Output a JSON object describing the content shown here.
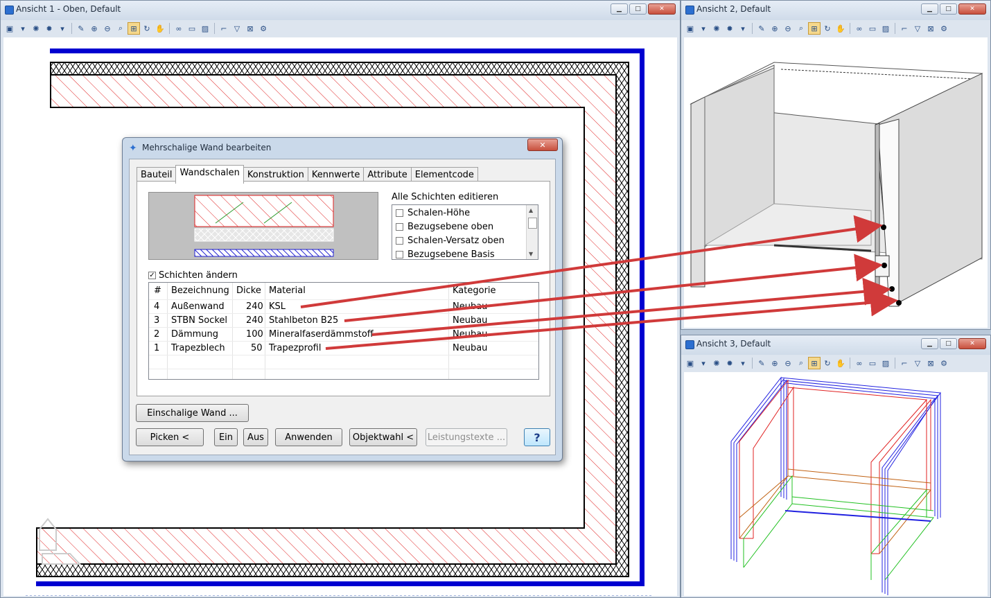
{
  "view1": {
    "title": "Ansicht 1 - Oben, Default"
  },
  "view2": {
    "title": "Ansicht 2, Default"
  },
  "view3": {
    "title": "Ansicht 3, Default"
  },
  "window_buttons": {
    "minimize": "▁",
    "maximize": "□",
    "close": "✕"
  },
  "dialog": {
    "title": "Mehrschalige Wand bearbeiten",
    "close_label": "✕",
    "tabs": [
      {
        "label": "Bauteil"
      },
      {
        "label": "Wandschalen"
      },
      {
        "label": "Konstruktion"
      },
      {
        "label": "Kennwerte"
      },
      {
        "label": "Attribute"
      },
      {
        "label": "Elementcode"
      }
    ],
    "all_layers_label": "Alle Schichten editieren",
    "layer_options": [
      {
        "label": "Schalen-Höhe"
      },
      {
        "label": "Bezugsebene oben"
      },
      {
        "label": "Schalen-Versatz oben"
      },
      {
        "label": "Bezugsebene Basis"
      }
    ],
    "change_layers_label": "Schichten ändern",
    "table": {
      "headers": {
        "num": "#",
        "name": "Bezeichnung",
        "thickness": "Dicke",
        "material": "Material",
        "category": "Kategorie"
      },
      "rows": [
        {
          "num": "4",
          "name": "Außenwand",
          "thickness": "240",
          "material": "KSL",
          "category": "Neubau"
        },
        {
          "num": "3",
          "name": "STBN Sockel",
          "thickness": "240",
          "material": "Stahlbeton B25",
          "category": "Neubau"
        },
        {
          "num": "2",
          "name": "Dämmung",
          "thickness": "100",
          "material": "Mineralfaserdämmstoff",
          "category": "Neubau"
        },
        {
          "num": "1",
          "name": "Trapezblech",
          "thickness": "50",
          "material": "Trapezprofil",
          "category": "Neubau"
        }
      ]
    },
    "buttons": {
      "single_wall": "Einschalige Wand ...",
      "pick": "Picken <",
      "on": "Ein",
      "off": "Aus",
      "apply": "Anwenden",
      "object_select": "Objektwahl <",
      "service_texts": "Leistungstexte ...",
      "help": "?"
    }
  },
  "colors": {
    "hatch_red": "#e02020",
    "wall_blue": "#0000d0",
    "arrow_red": "#d03a3a",
    "title_bg": "#dde5ef"
  }
}
